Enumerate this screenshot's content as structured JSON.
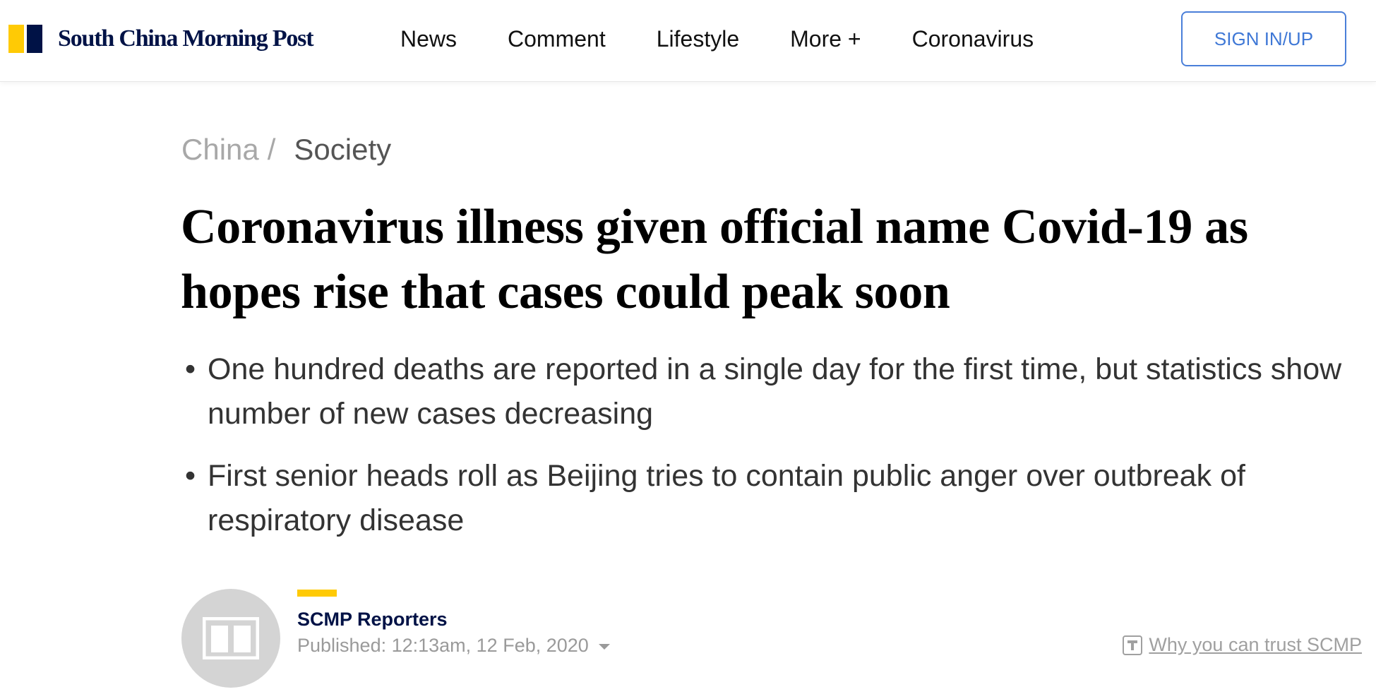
{
  "header": {
    "logo_text": "South China Morning Post",
    "brand_colors": {
      "yellow": "#ffca05",
      "navy": "#001246"
    },
    "nav": [
      {
        "label": "News"
      },
      {
        "label": "Comment"
      },
      {
        "label": "Lifestyle"
      },
      {
        "label": "More +"
      },
      {
        "label": "Coronavirus"
      }
    ],
    "signin_label": "SIGN IN/UP",
    "signin_color": "#3f78d6"
  },
  "article": {
    "breadcrumb": {
      "section": "China",
      "separator": "/",
      "subsection": "Society"
    },
    "headline": "Coronavirus illness given official name Covid-19 as hopes rise that cases could peak soon",
    "summary": [
      "One hundred deaths are reported in a single day for the first time, but statistics show number of new cases decreasing",
      "First senior heads roll as Beijing tries to contain public anger over outbreak of respiratory disease"
    ],
    "bullet_glyph": "•",
    "author": {
      "avatar_icon": "placeholder-avatar-icon",
      "name": "SCMP Reporters",
      "published": "Published: 12:13am, 12 Feb, 2020"
    },
    "trust": {
      "icon": "trust-t-icon",
      "label": "Why you can trust SCMP"
    }
  }
}
